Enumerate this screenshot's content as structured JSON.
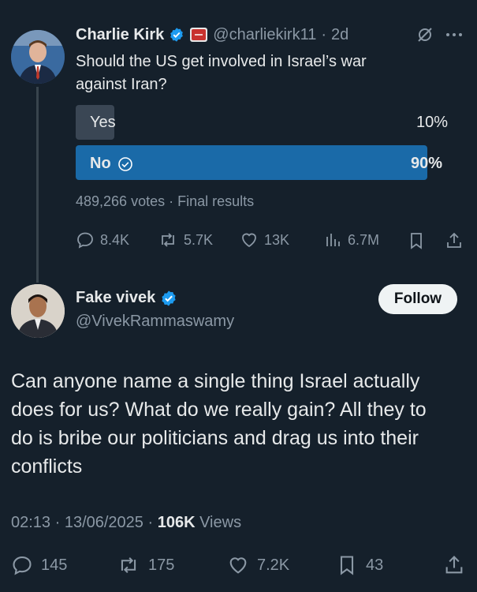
{
  "quoted": {
    "author": "Charlie Kirk",
    "handle": "@charliekirk11",
    "time": "2d",
    "text_line1": "Should the US get involved in Israel’s war",
    "text_line2": "against Iran?",
    "poll": {
      "options": [
        {
          "label": "Yes",
          "percent_label": "10%",
          "percent": 10,
          "winner": false
        },
        {
          "label": "No",
          "percent_label": "90%",
          "percent": 90,
          "winner": true
        }
      ],
      "votes": "489,266 votes",
      "status": "Final results"
    },
    "stats": {
      "replies": "8.4K",
      "reposts": "5.7K",
      "likes": "13K",
      "views": "6.7M"
    }
  },
  "reply": {
    "author": "Fake vivek",
    "handle": "@VivekRammaswamy",
    "follow_label": "Follow",
    "body_lines": [
      "Can anyone name a single thing Israel actually",
      "does for us? What do we really gain? All they to",
      "do is bribe our politicians and drag us into their",
      "conflicts"
    ],
    "timestamp": "02:13 · 13/06/2025",
    "views_count": "106K",
    "views_label": "Views",
    "stats": {
      "replies": "145",
      "reposts": "175",
      "likes": "7.2K",
      "bookmarks": "43"
    }
  },
  "colors": {
    "background": "#15202b",
    "accent": "#1d9bf0",
    "poll_winner": "#1a6aa8",
    "poll_other": "#3a4654",
    "muted": "#8b98a5"
  }
}
